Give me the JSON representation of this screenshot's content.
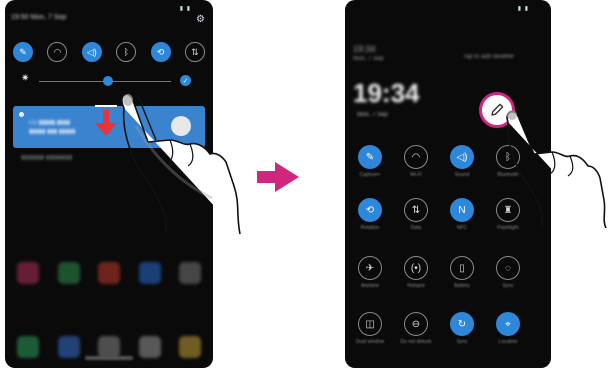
{
  "phone_before": {
    "date_line": "19:50 Mon, 7 Sep",
    "status_glyphs": "▮ ▮",
    "quick_icons": [
      {
        "name": "edit-icon",
        "glyph": "✎",
        "on": true
      },
      {
        "name": "wifi-icon",
        "glyph": "◠",
        "on": false
      },
      {
        "name": "sound-icon",
        "glyph": "◁)",
        "on": true
      },
      {
        "name": "bluetooth-icon",
        "glyph": "ᛒ",
        "on": false
      },
      {
        "name": "rotation-icon",
        "glyph": "⟲",
        "on": true
      },
      {
        "name": "data-icon",
        "glyph": "⇅",
        "on": false
      }
    ],
    "notification": {
      "line1": "LG ▮▮▮▮▮ ▮▮▮▮",
      "line2": "▮▮▮▮▮ ▮▮▮ ▮▮▮▮▮"
    },
    "below_text": "▮▮▮▮▮▮▮ ▮▮▮▮▮▮▮▮",
    "accent": "#2e87d8"
  },
  "phone_after": {
    "status_glyphs": "▮ ▮",
    "top_line_left": "19:34",
    "top_sub_left": "Mon, 7 Sep",
    "top_sub_right": "Tap to add weather",
    "clock": "19:34",
    "clock_date": "Mon, 7 Sep",
    "tiles": [
      {
        "label": "Capture+",
        "glyph": "✎",
        "on": true
      },
      {
        "label": "Wi-Fi",
        "glyph": "◠",
        "on": false
      },
      {
        "label": "Sound",
        "glyph": "◁)",
        "on": true
      },
      {
        "label": "Bluetooth",
        "glyph": "ᛒ",
        "on": false
      },
      {
        "label": "Rotation",
        "glyph": "⟲",
        "on": true
      },
      {
        "label": "Data",
        "glyph": "⇅",
        "on": false
      },
      {
        "label": "NFC",
        "glyph": "N",
        "on": true
      },
      {
        "label": "Flashlight",
        "glyph": "♜",
        "on": false
      },
      {
        "label": "Airplane",
        "glyph": "✈",
        "on": false
      },
      {
        "label": "Hotspot",
        "glyph": "(•)",
        "on": false
      },
      {
        "label": "Battery",
        "glyph": "▯",
        "on": false
      },
      {
        "label": "Sync",
        "glyph": "◌",
        "on": false
      },
      {
        "label": "Dual window",
        "glyph": "◫",
        "on": false
      },
      {
        "label": "Do not disturb",
        "glyph": "⊖",
        "on": false
      },
      {
        "label": "Sync",
        "glyph": "↻",
        "on": true
      },
      {
        "label": "Location",
        "glyph": "⌖",
        "on": true
      }
    ],
    "edit_highlight_color": "#d0267e"
  },
  "arrow_color": "#d0267e"
}
